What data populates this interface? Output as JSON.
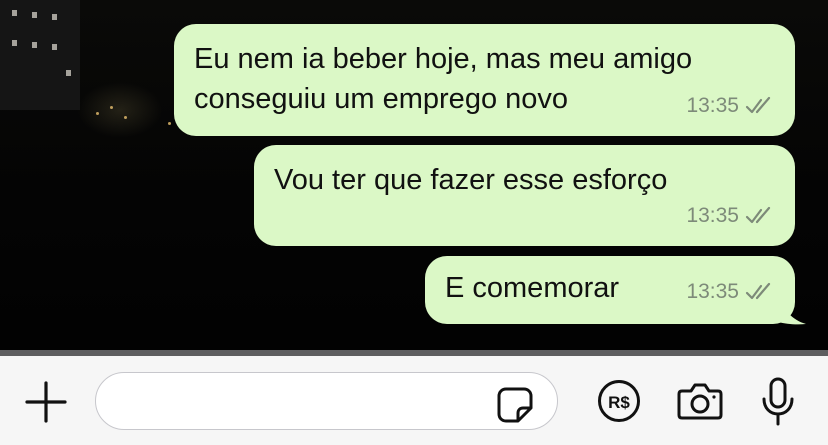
{
  "messages": [
    {
      "lines": [
        "Eu nem ia beber hoje, mas meu amigo",
        "conseguiu um emprego novo"
      ],
      "time": "13:35",
      "status": "read"
    },
    {
      "lines": [
        "Vou ter que fazer esse esforço"
      ],
      "time": "13:35",
      "status": "read"
    },
    {
      "lines": [
        "E comemorar"
      ],
      "time": "13:35",
      "status": "read"
    }
  ],
  "composer": {
    "value": "",
    "placeholder": ""
  },
  "icons": {
    "attach": "plus-icon",
    "sticker": "sticker-icon",
    "payment": "real-currency-icon",
    "camera": "camera-icon",
    "microphone": "microphone-icon"
  },
  "colors": {
    "outgoing_bubble": "#dbf8c6",
    "read_ticks": "#7d8a79",
    "input_bar": "#f6f6f6",
    "icon": "#111111"
  }
}
